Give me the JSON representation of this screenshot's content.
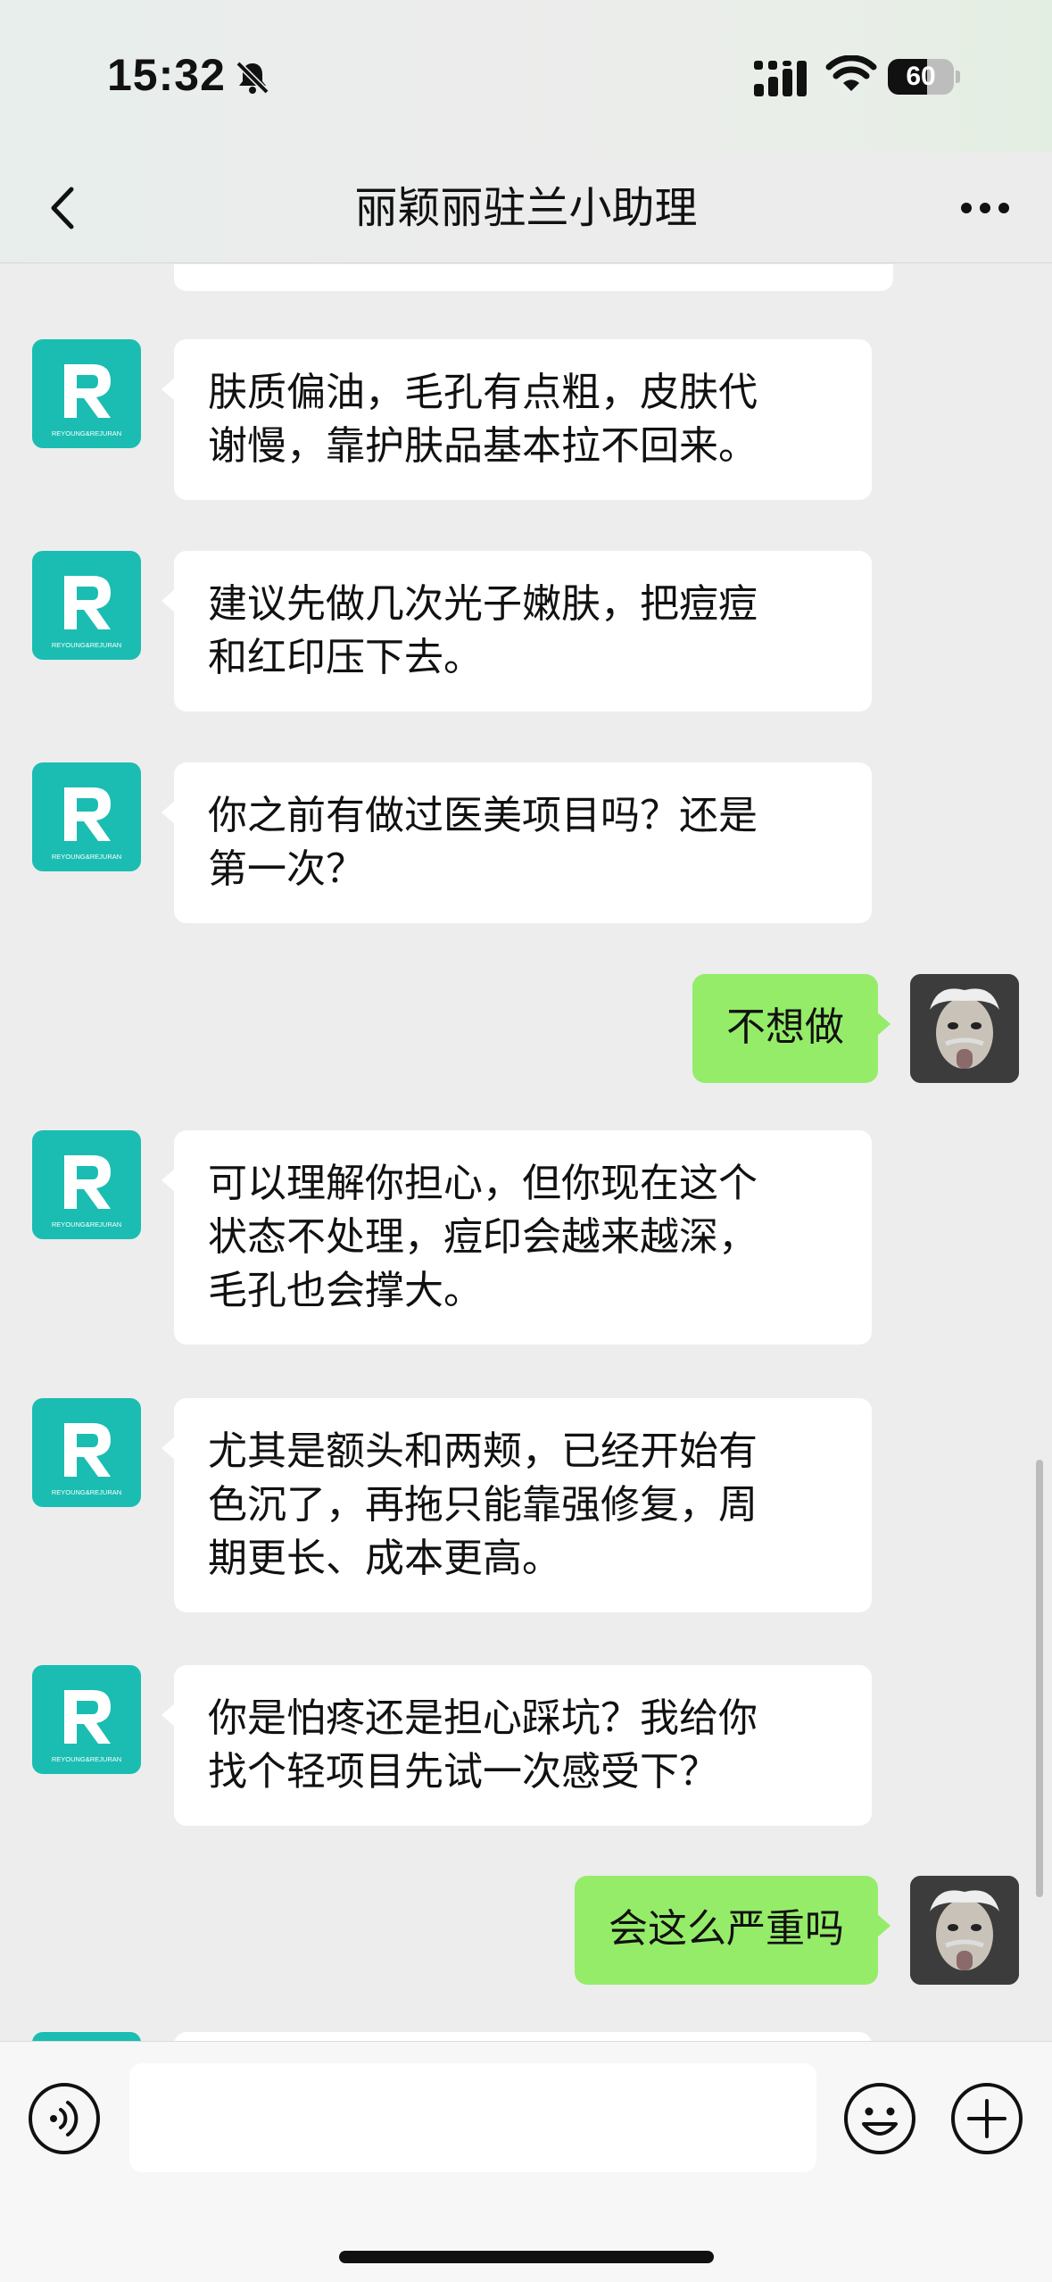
{
  "status_bar": {
    "time": "15:32",
    "battery_percent": "60",
    "battery_level": 0.6,
    "icons": [
      "bell-slash-icon",
      "cellular-signal-icon",
      "wifi-icon",
      "battery-icon"
    ]
  },
  "nav": {
    "title": "丽颖丽驻兰小助理",
    "back_icon": "chevron-left-icon",
    "more_icon": "more-dots-icon"
  },
  "bot_avatar_caption": "REYOUNG&REJURAN",
  "messages": [
    {
      "side": "in",
      "lines": [
        "肤质偏油，毛孔有点粗，皮肤代",
        "谢慢，靠护肤品基本拉不回来。"
      ]
    },
    {
      "side": "in",
      "lines": [
        "建议先做几次光子嫩肤，把痘痘",
        "和红印压下去。"
      ]
    },
    {
      "side": "in",
      "lines": [
        "你之前有做过医美项目吗？还是",
        "第一次？"
      ]
    },
    {
      "side": "out",
      "lines": [
        "不想做"
      ]
    },
    {
      "side": "in",
      "lines": [
        "可以理解你担心，但你现在这个",
        "状态不处理，痘印会越来越深，",
        "毛孔也会撑大。"
      ]
    },
    {
      "side": "in",
      "lines": [
        "尤其是额头和两颊，已经开始有",
        "色沉了，再拖只能靠强修复，周",
        "期更长、成本更高。"
      ]
    },
    {
      "side": "in",
      "lines": [
        "你是怕疼还是担心踩坑？我给你",
        "找个轻项目先试一次感受下？"
      ]
    },
    {
      "side": "out",
      "lines": [
        "会这么严重吗"
      ]
    }
  ],
  "input_bar": {
    "text": "",
    "icons": [
      "voice-icon",
      "emoji-icon",
      "plus-icon"
    ]
  }
}
